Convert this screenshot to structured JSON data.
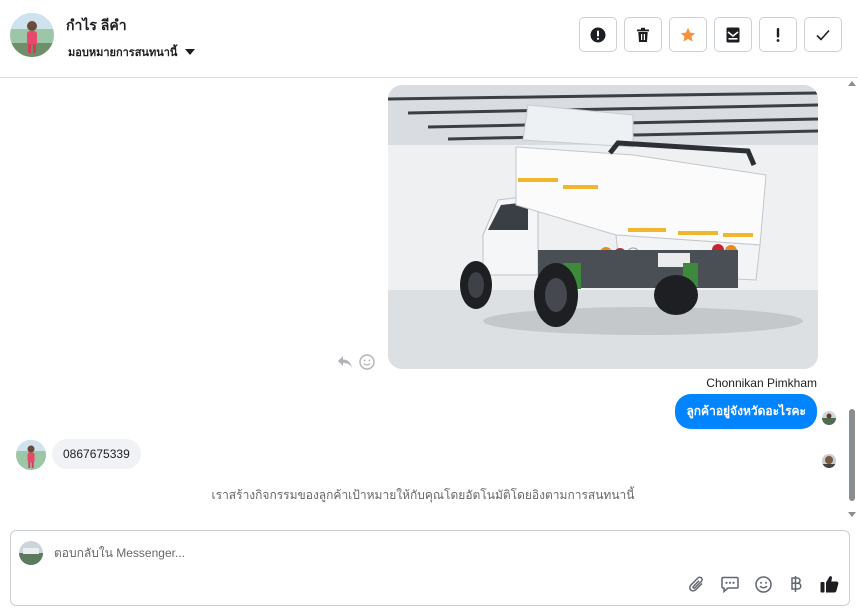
{
  "header": {
    "contact_name": "กำไร ลีคำ",
    "assign_label": "มอบหมายการสนทนานี้",
    "actions": [
      {
        "name": "mark-spam-button",
        "icon": "alert-circle-icon"
      },
      {
        "name": "delete-button",
        "icon": "trash-icon"
      },
      {
        "name": "star-button",
        "icon": "star-icon"
      },
      {
        "name": "mark-unread-button",
        "icon": "envelope-icon"
      },
      {
        "name": "follow-up-button",
        "icon": "exclamation-icon"
      },
      {
        "name": "mark-done-button",
        "icon": "check-icon"
      }
    ]
  },
  "thread": {
    "sender_name": "Chonnikan Pimkham",
    "outgoing_message": "ลูกค้าอยู่จังหวัดอะไรคะ",
    "incoming_message": "0867675339",
    "system_note": "เราสร้างกิจกรรมของลูกค้าเป้าหมายให้กับคุณโดยอัตโนมัติโดยอิงตามการสนทนานี้"
  },
  "composer": {
    "placeholder": "ตอบกลับใน Messenger...",
    "tools": [
      "paperclip-icon",
      "saved-replies-icon",
      "emoji-icon",
      "baht-icon",
      "thumbs-up-icon"
    ]
  },
  "colors": {
    "accent": "#0084ff",
    "star": "#f7923a",
    "incoming_bubble": "#f0f2f5"
  }
}
